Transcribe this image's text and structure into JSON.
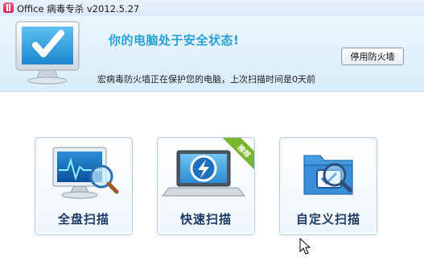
{
  "window": {
    "title": "Office 病毒专杀 v2012.5.27"
  },
  "status": {
    "headline": "你的电脑处于安全状态!",
    "detail": "宏病毒防火墙正在保护您的电脑，上次扫描时间是0天前",
    "disable_button": "停用防火墙"
  },
  "scan_options": [
    {
      "label": "全盘扫描",
      "icon": "monitor-magnifier-icon"
    },
    {
      "label": "快速扫描",
      "icon": "laptop-lightning-icon",
      "badge": "推荐"
    },
    {
      "label": "自定义扫描",
      "icon": "folder-scan-icon"
    }
  ],
  "colors": {
    "headline": "#2aa0d8",
    "label": "#1d3a66",
    "badge": "#77b52c"
  }
}
